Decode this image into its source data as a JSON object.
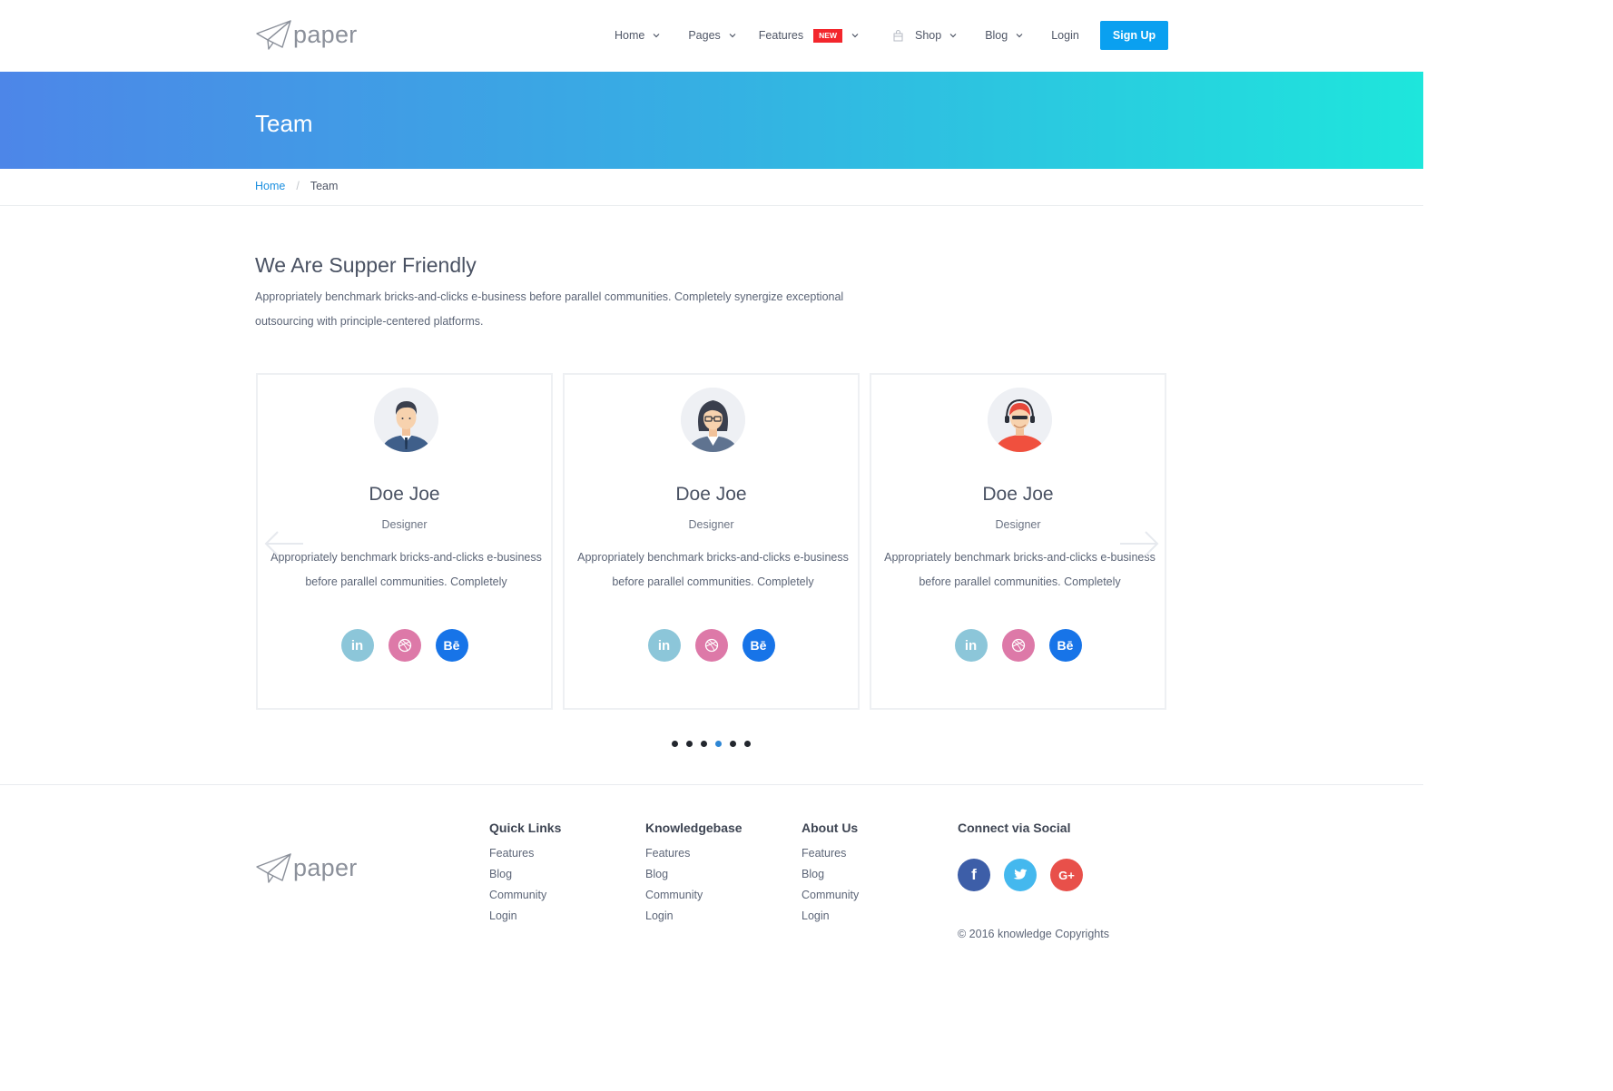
{
  "brand": {
    "logo_text": "paper"
  },
  "nav": {
    "items": [
      {
        "label": "Home"
      },
      {
        "label": "Pages"
      },
      {
        "label": "Features",
        "badge": "NEW"
      },
      {
        "label": "Shop"
      },
      {
        "label": "Blog"
      },
      {
        "label": "Login"
      }
    ],
    "signup_label": "Sign Up"
  },
  "hero": {
    "title": "Team"
  },
  "breadcrumb": {
    "home": "Home",
    "separator": "/",
    "current": "Team"
  },
  "intro": {
    "title": "We Are Supper Friendly",
    "text": "Appropriately benchmark bricks-and-clicks e-business before parallel communities. Completely synergize exceptional outsourcing with principle-centered platforms."
  },
  "team": [
    {
      "name": "Doe Joe",
      "role": "Designer",
      "desc": "Appropriately benchmark bricks-and-clicks e-business before parallel communities. Completely",
      "avatar": "man-in-suit-avatar-icon"
    },
    {
      "name": "Doe Joe",
      "role": "Designer",
      "desc": "Appropriately benchmark bricks-and-clicks e-business before parallel communities. Completely",
      "avatar": "woman-with-glasses-avatar-icon"
    },
    {
      "name": "Doe Joe",
      "role": "Designer",
      "desc": "Appropriately benchmark bricks-and-clicks e-business before parallel communities. Completely",
      "avatar": "gamer-with-headset-avatar-icon"
    }
  ],
  "social_labels": {
    "linkedin": "in",
    "behance": "Bē"
  },
  "carousel": {
    "page_count": 6,
    "active_page": 4
  },
  "footer": {
    "columns": [
      {
        "title": "Quick Links",
        "links": [
          "Features",
          "Blog",
          "Community",
          "Login"
        ]
      },
      {
        "title": "Knowledgebase",
        "links": [
          "Features",
          "Blog",
          "Community",
          "Login"
        ]
      },
      {
        "title": "About Us",
        "links": [
          "Features",
          "Blog",
          "Community",
          "Login"
        ]
      }
    ],
    "social_title": "Connect via Social",
    "social_labels": {
      "facebook": "f",
      "google_plus": "G+"
    },
    "copyright": "© 2016 knowledge Copyrights"
  },
  "colors": {
    "accent": "#0aa0f0",
    "badge": "#f3262c",
    "hero_start": "#4d86e8",
    "hero_end": "#1ee6dc",
    "linkedin": "#8cc6d9",
    "dribbble": "#dd79a8",
    "behance": "#1774e8",
    "facebook": "#3d5ea8",
    "twitter": "#44b8ee",
    "google_plus": "#e8504a"
  }
}
